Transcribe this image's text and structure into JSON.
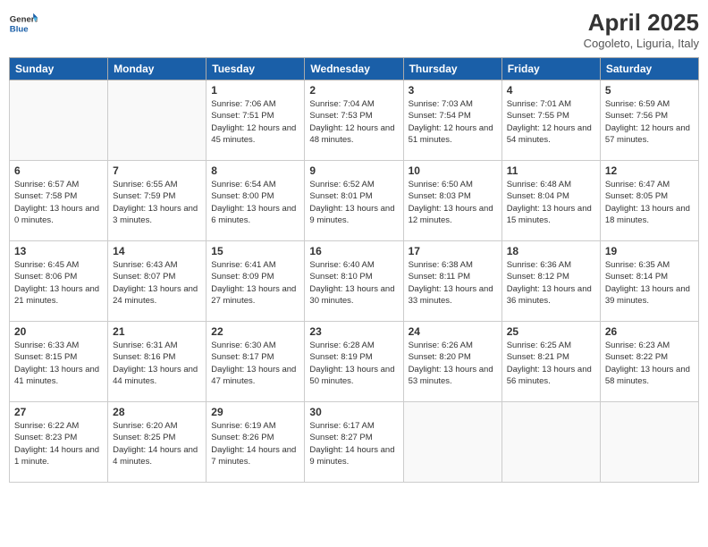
{
  "logo": {
    "line1": "General",
    "line2": "Blue"
  },
  "title": "April 2025",
  "subtitle": "Cogoleto, Liguria, Italy",
  "days_header": [
    "Sunday",
    "Monday",
    "Tuesday",
    "Wednesday",
    "Thursday",
    "Friday",
    "Saturday"
  ],
  "weeks": [
    [
      {
        "day": "",
        "info": ""
      },
      {
        "day": "",
        "info": ""
      },
      {
        "day": "1",
        "info": "Sunrise: 7:06 AM\nSunset: 7:51 PM\nDaylight: 12 hours and 45 minutes."
      },
      {
        "day": "2",
        "info": "Sunrise: 7:04 AM\nSunset: 7:53 PM\nDaylight: 12 hours and 48 minutes."
      },
      {
        "day": "3",
        "info": "Sunrise: 7:03 AM\nSunset: 7:54 PM\nDaylight: 12 hours and 51 minutes."
      },
      {
        "day": "4",
        "info": "Sunrise: 7:01 AM\nSunset: 7:55 PM\nDaylight: 12 hours and 54 minutes."
      },
      {
        "day": "5",
        "info": "Sunrise: 6:59 AM\nSunset: 7:56 PM\nDaylight: 12 hours and 57 minutes."
      }
    ],
    [
      {
        "day": "6",
        "info": "Sunrise: 6:57 AM\nSunset: 7:58 PM\nDaylight: 13 hours and 0 minutes."
      },
      {
        "day": "7",
        "info": "Sunrise: 6:55 AM\nSunset: 7:59 PM\nDaylight: 13 hours and 3 minutes."
      },
      {
        "day": "8",
        "info": "Sunrise: 6:54 AM\nSunset: 8:00 PM\nDaylight: 13 hours and 6 minutes."
      },
      {
        "day": "9",
        "info": "Sunrise: 6:52 AM\nSunset: 8:01 PM\nDaylight: 13 hours and 9 minutes."
      },
      {
        "day": "10",
        "info": "Sunrise: 6:50 AM\nSunset: 8:03 PM\nDaylight: 13 hours and 12 minutes."
      },
      {
        "day": "11",
        "info": "Sunrise: 6:48 AM\nSunset: 8:04 PM\nDaylight: 13 hours and 15 minutes."
      },
      {
        "day": "12",
        "info": "Sunrise: 6:47 AM\nSunset: 8:05 PM\nDaylight: 13 hours and 18 minutes."
      }
    ],
    [
      {
        "day": "13",
        "info": "Sunrise: 6:45 AM\nSunset: 8:06 PM\nDaylight: 13 hours and 21 minutes."
      },
      {
        "day": "14",
        "info": "Sunrise: 6:43 AM\nSunset: 8:07 PM\nDaylight: 13 hours and 24 minutes."
      },
      {
        "day": "15",
        "info": "Sunrise: 6:41 AM\nSunset: 8:09 PM\nDaylight: 13 hours and 27 minutes."
      },
      {
        "day": "16",
        "info": "Sunrise: 6:40 AM\nSunset: 8:10 PM\nDaylight: 13 hours and 30 minutes."
      },
      {
        "day": "17",
        "info": "Sunrise: 6:38 AM\nSunset: 8:11 PM\nDaylight: 13 hours and 33 minutes."
      },
      {
        "day": "18",
        "info": "Sunrise: 6:36 AM\nSunset: 8:12 PM\nDaylight: 13 hours and 36 minutes."
      },
      {
        "day": "19",
        "info": "Sunrise: 6:35 AM\nSunset: 8:14 PM\nDaylight: 13 hours and 39 minutes."
      }
    ],
    [
      {
        "day": "20",
        "info": "Sunrise: 6:33 AM\nSunset: 8:15 PM\nDaylight: 13 hours and 41 minutes."
      },
      {
        "day": "21",
        "info": "Sunrise: 6:31 AM\nSunset: 8:16 PM\nDaylight: 13 hours and 44 minutes."
      },
      {
        "day": "22",
        "info": "Sunrise: 6:30 AM\nSunset: 8:17 PM\nDaylight: 13 hours and 47 minutes."
      },
      {
        "day": "23",
        "info": "Sunrise: 6:28 AM\nSunset: 8:19 PM\nDaylight: 13 hours and 50 minutes."
      },
      {
        "day": "24",
        "info": "Sunrise: 6:26 AM\nSunset: 8:20 PM\nDaylight: 13 hours and 53 minutes."
      },
      {
        "day": "25",
        "info": "Sunrise: 6:25 AM\nSunset: 8:21 PM\nDaylight: 13 hours and 56 minutes."
      },
      {
        "day": "26",
        "info": "Sunrise: 6:23 AM\nSunset: 8:22 PM\nDaylight: 13 hours and 58 minutes."
      }
    ],
    [
      {
        "day": "27",
        "info": "Sunrise: 6:22 AM\nSunset: 8:23 PM\nDaylight: 14 hours and 1 minute."
      },
      {
        "day": "28",
        "info": "Sunrise: 6:20 AM\nSunset: 8:25 PM\nDaylight: 14 hours and 4 minutes."
      },
      {
        "day": "29",
        "info": "Sunrise: 6:19 AM\nSunset: 8:26 PM\nDaylight: 14 hours and 7 minutes."
      },
      {
        "day": "30",
        "info": "Sunrise: 6:17 AM\nSunset: 8:27 PM\nDaylight: 14 hours and 9 minutes."
      },
      {
        "day": "",
        "info": ""
      },
      {
        "day": "",
        "info": ""
      },
      {
        "day": "",
        "info": ""
      }
    ]
  ]
}
